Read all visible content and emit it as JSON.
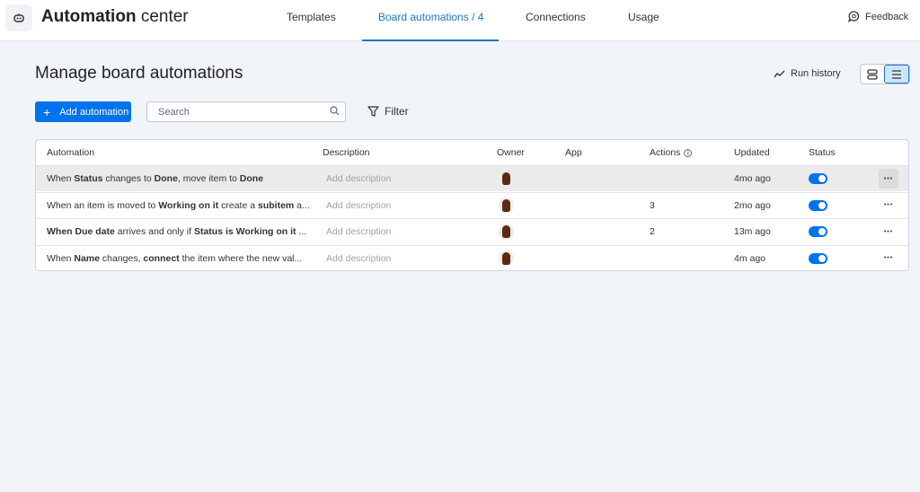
{
  "header": {
    "app_title_bold": "Automation",
    "app_title_rest": " center",
    "tabs": [
      {
        "label": "Templates"
      },
      {
        "label": "Board automations / 4",
        "active": true
      },
      {
        "label": "Connections"
      },
      {
        "label": "Usage"
      }
    ],
    "feedback": "Feedback"
  },
  "page": {
    "title": "Manage board automations",
    "run_history": "Run history",
    "add_automation": "Add automation",
    "search_placeholder": "Search",
    "filter": "Filter"
  },
  "table": {
    "columns": [
      "Automation",
      "Description",
      "Owner",
      "App",
      "Actions",
      "Updated",
      "Status"
    ],
    "rows": [
      {
        "automation": [
          {
            "t": "When "
          },
          {
            "t": "Status",
            "b": true
          },
          {
            "t": " changes to "
          },
          {
            "t": "Done",
            "b": true
          },
          {
            "t": ", move item to "
          },
          {
            "t": "Done",
            "b": true
          }
        ],
        "description": "Add description",
        "actions": "",
        "updated": "4mo ago",
        "status_on": true
      },
      {
        "automation": [
          {
            "t": "When an item is moved to "
          },
          {
            "t": "Working on it",
            "b": true
          },
          {
            "t": " create a "
          },
          {
            "t": "subitem",
            "b": true
          },
          {
            "t": " a..."
          }
        ],
        "description": "Add description",
        "actions": "3",
        "updated": "2mo ago",
        "status_on": true
      },
      {
        "automation": [
          {
            "t": "When ",
            "b": true
          },
          {
            "t": "Due date",
            "b": true
          },
          {
            "t": " arrives and only if "
          },
          {
            "t": "Status",
            "b": true
          },
          {
            "t": " is ",
            "b": true
          },
          {
            "t": "Working on it",
            "b": true
          },
          {
            "t": " ..."
          }
        ],
        "description": "Add description",
        "actions": "2",
        "updated": "13m ago",
        "status_on": true
      },
      {
        "automation": [
          {
            "t": "When "
          },
          {
            "t": "Name",
            "b": true
          },
          {
            "t": " changes, "
          },
          {
            "t": "connect",
            "b": true
          },
          {
            "t": " the item where the new val..."
          }
        ],
        "description": "Add description",
        "actions": "",
        "updated": "4m ago",
        "status_on": true
      }
    ]
  },
  "colors": {
    "accent": "#0073ea",
    "tab_active": "#1f76c2"
  }
}
